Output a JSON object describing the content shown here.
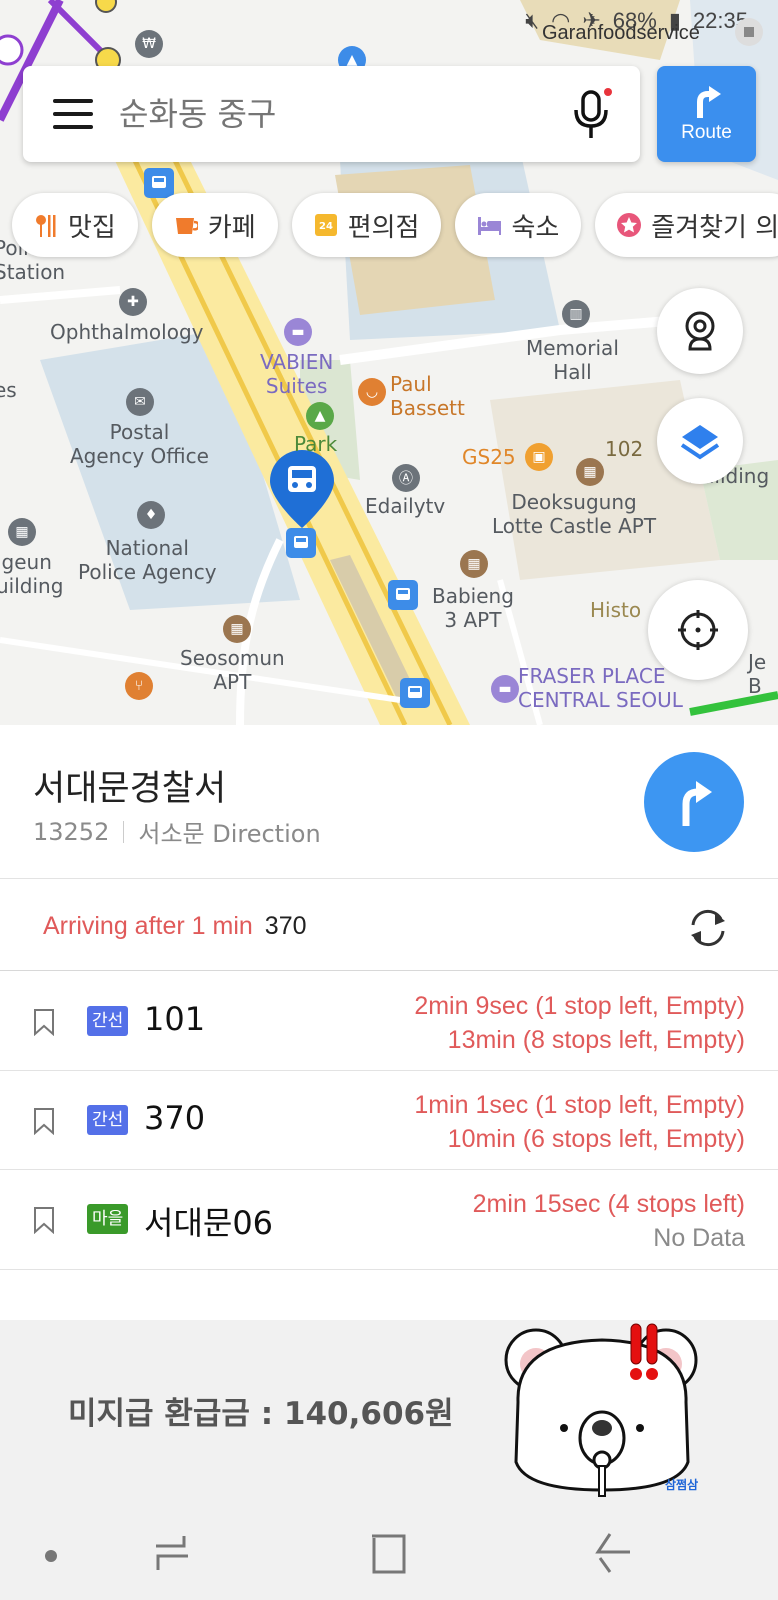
{
  "status_bar": {
    "battery": "68%",
    "time": "22:35",
    "overlay_app": "Garanfoodservice",
    "icons": [
      "mute-icon",
      "wifi-icon",
      "airplane-icon",
      "battery-icon"
    ]
  },
  "search": {
    "placeholder": "순화동 중구",
    "menu_icon": "hamburger-icon",
    "mic_icon": "microphone-icon"
  },
  "route_button": {
    "label": "Route",
    "icon": "turn-right-arrow-icon"
  },
  "chips": [
    {
      "label": "맛집",
      "icon": "restaurant-icon",
      "color": "#f07b2c"
    },
    {
      "label": "카페",
      "icon": "cafe-icon",
      "color": "#f07b2c"
    },
    {
      "label": "편의점",
      "icon": "convenience-store-icon",
      "color": "#f5b82e"
    },
    {
      "label": "숙소",
      "icon": "hotel-icon",
      "color": "#9a86d6"
    },
    {
      "label": "즐겨찾기 의",
      "icon": "favorite-star-icon",
      "color": "#e8567a"
    }
  ],
  "map": {
    "labels": {
      "police_station": "Police\nStation",
      "ophthalmology": "Ophthalmology",
      "vabien": "VABIEN\nSuites",
      "memorial": "Memorial\nHall",
      "paul": "Paul\nBassett",
      "postal": "Postal\nAgency Office",
      "park": "Park",
      "gs25": "GS25",
      "num102": "102",
      "deoksugung": "Deoksugung\nLotte Castle APT",
      "edailytv": "Edailytv",
      "national_police": "National\nPolice Agency",
      "igeun": "igeun\nuilding",
      "babieng": "Babieng\n3 APT",
      "histo": "Histo",
      "seosomun": "Seosomun\nAPT",
      "fraser": "FRASER PLACE\nCENTRAL SEOUL",
      "building_right": "din\nBuilding",
      "es": "es",
      "je": "Je\nB"
    },
    "fabs": [
      "cctv-icon",
      "layers-icon",
      "my-location-icon"
    ]
  },
  "stop": {
    "name": "서대문경찰서",
    "id": "13252",
    "direction": "서소문 Direction"
  },
  "arriving": {
    "text": "Arriving after 1 min",
    "bus": "370"
  },
  "buses": [
    {
      "type": "간선",
      "type_color": "#5470e8",
      "number": "101",
      "times": [
        "2min 9sec (1 stop left, Empty)",
        "13min (8 stops left, Empty)"
      ]
    },
    {
      "type": "간선",
      "type_color": "#5470e8",
      "number": "370",
      "times": [
        "1min 1sec (1 stop left, Empty)",
        "10min (6 stops left, Empty)"
      ]
    },
    {
      "type": "마을",
      "type_color": "#3a9a2a",
      "number": "서대문06",
      "times": [
        "2min 15sec (4 stops left)",
        "No Data"
      ]
    }
  ],
  "ad": {
    "text": "미지급 환급금 : 140,606원",
    "brand": "삼쩜삼"
  },
  "navbar": {
    "buttons": [
      "dot-icon",
      "recent-apps-icon",
      "home-icon",
      "back-icon"
    ]
  }
}
